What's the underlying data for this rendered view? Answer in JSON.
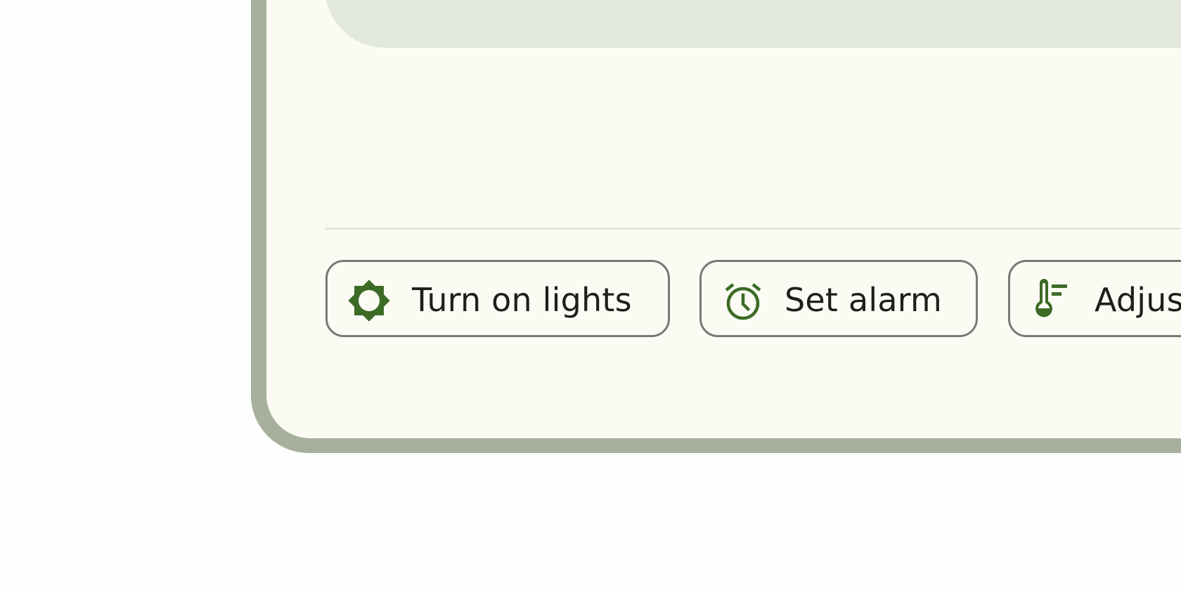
{
  "colors": {
    "frame": "#A6B09C",
    "screen_background": "#FBFBF4",
    "top_panel": "#E2E8DC",
    "divider": "#E3E5DC",
    "chip_border": "#777A73",
    "icon_accent": "#3D6B26",
    "text": "#1E1F1B"
  },
  "suggestions": [
    {
      "label": "Turn on lights",
      "icon": "brightness-icon"
    },
    {
      "label": "Set alarm",
      "icon": "alarm-clock-icon"
    },
    {
      "label": "Adjus",
      "icon": "thermostat-icon"
    }
  ]
}
